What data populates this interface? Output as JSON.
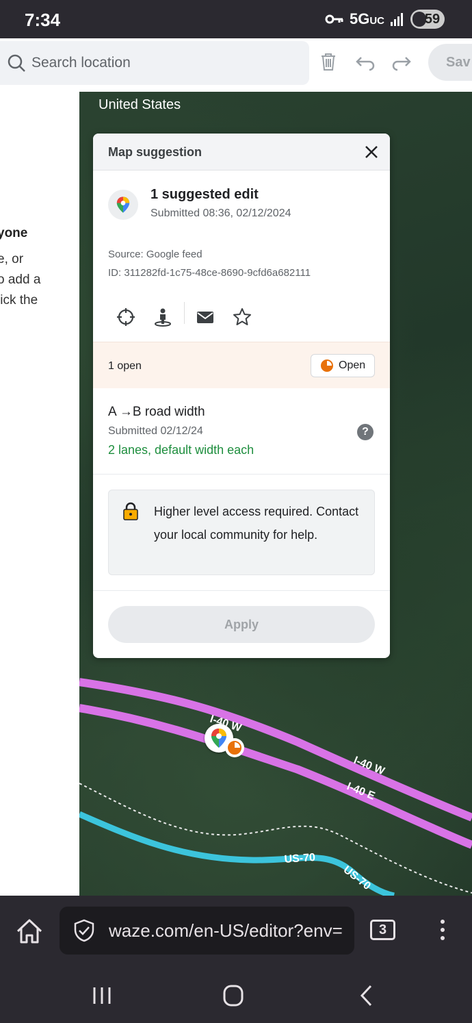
{
  "status_bar": {
    "time": "7:34",
    "network": "5G",
    "network_suffix": "UC",
    "battery": "59"
  },
  "toolbar": {
    "search_placeholder": "Search location",
    "delete_icon": "trash-icon",
    "undo_icon": "undo-icon",
    "redo_icon": "redo-icon",
    "save_label": "Sav"
  },
  "left_panel": {
    "heading_fragment": "yone",
    "lines": [
      "e, or",
      "o add a",
      "lick the"
    ]
  },
  "map": {
    "country_label": "United States",
    "road_labels": [
      "I-40 W",
      "I-40 W",
      "I-40 E",
      "US-70",
      "US-70"
    ]
  },
  "dialog": {
    "title": "Map suggestion",
    "suggestion_title": "1 suggested edit",
    "submitted": "Submitted 08:36, 02/12/2024",
    "source": "Source: Google feed",
    "id": "ID: 311282fd-1c75-48ce-8690-9cfd6a682111",
    "actions": [
      "crosshair-icon",
      "street-view-icon",
      "envelope-icon",
      "star-icon"
    ],
    "open_count": "1 open",
    "open_status": "Open",
    "edit": {
      "title": "A →B road width",
      "submitted": "Submitted 02/12/24",
      "value": "2 lanes, default width each"
    },
    "access_message": "Higher level access required. Contact your local community for help.",
    "apply_label": "Apply"
  },
  "browser": {
    "url": "waze.com/en-US/editor?env=",
    "tab_count": "3"
  },
  "colors": {
    "accent_orange": "#e8710a",
    "value_green": "#1e8e3e",
    "highway_pink": "#d873e6",
    "us_route_cyan": "#3cc4dc"
  }
}
